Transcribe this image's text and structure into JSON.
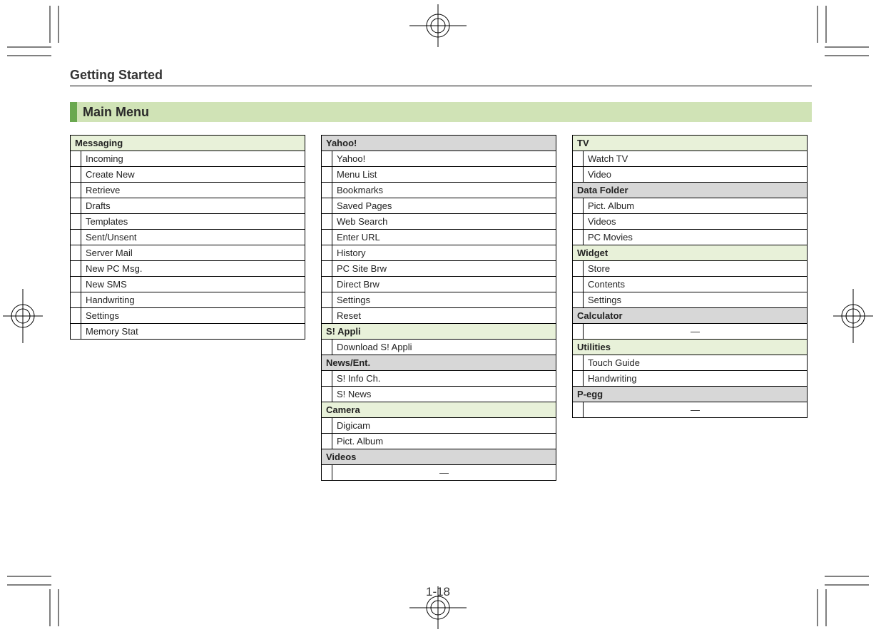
{
  "chapter": "Getting Started",
  "section": "Main Menu",
  "page_number": "1-18",
  "em_dash": "—",
  "columns": [
    {
      "sections": [
        {
          "title": "Messaging",
          "style": "green",
          "items": [
            "Incoming",
            "Create New",
            "Retrieve",
            "Drafts",
            "Templates",
            "Sent/Unsent",
            "Server Mail",
            "New PC Msg.",
            "New SMS",
            "Handwriting",
            "Settings",
            "Memory Stat"
          ]
        }
      ]
    },
    {
      "sections": [
        {
          "title": "Yahoo!",
          "style": "grey",
          "items": [
            "Yahoo!",
            "Menu List",
            "Bookmarks",
            "Saved Pages",
            "Web Search",
            "Enter URL",
            "History",
            "PC Site Brw",
            "Direct Brw",
            "Settings",
            "Reset"
          ]
        },
        {
          "title": "S! Appli",
          "style": "green",
          "items": [
            "Download S! Appli"
          ]
        },
        {
          "title": "News/Ent.",
          "style": "grey",
          "items": [
            "S! Info Ch.",
            "S! News"
          ]
        },
        {
          "title": "Camera",
          "style": "green",
          "items": [
            "Digicam",
            "Pict. Album"
          ]
        },
        {
          "title": "Videos",
          "style": "grey",
          "items": [
            "—"
          ],
          "center": true
        }
      ]
    },
    {
      "sections": [
        {
          "title": "TV",
          "style": "green",
          "items": [
            "Watch TV",
            "Video"
          ]
        },
        {
          "title": "Data Folder",
          "style": "grey",
          "items": [
            "Pict. Album",
            "Videos",
            "PC Movies"
          ]
        },
        {
          "title": "Widget",
          "style": "green",
          "items": [
            "Store",
            "Contents",
            "Settings"
          ]
        },
        {
          "title": "Calculator",
          "style": "grey",
          "items": [
            "—"
          ],
          "center": true
        },
        {
          "title": "Utilities",
          "style": "green",
          "items": [
            "Touch Guide",
            "Handwriting"
          ]
        },
        {
          "title": "P-egg",
          "style": "grey",
          "items": [
            "—"
          ],
          "center": true
        }
      ]
    }
  ]
}
